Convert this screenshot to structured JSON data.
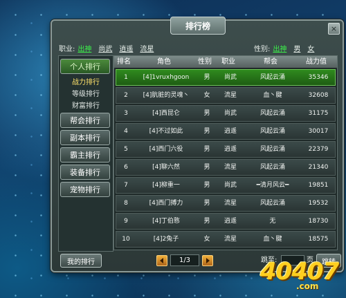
{
  "window": {
    "title": "排行榜",
    "close": "×"
  },
  "filters": {
    "job_label": "职业:",
    "jobs": [
      "出神",
      "尚武",
      "逍遥",
      "流星"
    ],
    "gender_label": "性别:",
    "genders": [
      "出神",
      "男",
      "女"
    ]
  },
  "sidebar": {
    "items": [
      {
        "label": "个人排行",
        "active": true
      },
      {
        "label": "帮会排行"
      },
      {
        "label": "副本排行"
      },
      {
        "label": "霸主排行"
      },
      {
        "label": "装备排行"
      },
      {
        "label": "宠物排行"
      }
    ],
    "subitems": [
      {
        "label": "战力排行",
        "active": true
      },
      {
        "label": "等级排行"
      },
      {
        "label": "财富排行"
      }
    ]
  },
  "table": {
    "headers": [
      "排名",
      "角色",
      "性别",
      "职业",
      "帮会",
      "战力值"
    ],
    "rows": [
      [
        "1",
        "[4]1vruxhgoon",
        "男",
        "尚武",
        "风起云涌",
        "35346"
      ],
      [
        "2",
        "[4]肮脏的灵魂丶",
        "女",
        "流星",
        "血丶腱",
        "32608"
      ],
      [
        "3",
        "[4]西昆仑",
        "男",
        "尚武",
        "风起云涌",
        "31175"
      ],
      [
        "4",
        "[4]不过如此",
        "男",
        "逍遥",
        "风起云涌",
        "30017"
      ],
      [
        "5",
        "[4]西门六役",
        "男",
        "逍遥",
        "风起云涌",
        "22379"
      ],
      [
        "6",
        "[4]聊六然",
        "男",
        "流星",
        "风起云涌",
        "21340"
      ],
      [
        "7",
        "[4]柳重一",
        "男",
        "尚武",
        "━清月风云━",
        "19851"
      ],
      [
        "8",
        "[4]西门搏力",
        "男",
        "流星",
        "风起云涌",
        "19532"
      ],
      [
        "9",
        "[4]丁伯憝",
        "男",
        "逍遥",
        "无",
        "18730"
      ],
      [
        "10",
        "[4]2兔子",
        "女",
        "流星",
        "血丶腱",
        "18575"
      ]
    ]
  },
  "footer": {
    "my_rank": "我的排行",
    "page": "1/3",
    "jump_label": "跳至:",
    "page_unit": "页",
    "jump_button": "跳转"
  },
  "watermark": {
    "number": "40407",
    "domain": ".com"
  },
  "colors": {
    "selected_row": "#2f8a1e",
    "active_filter": "#3cf04a",
    "panel": "#3d4d4c"
  }
}
